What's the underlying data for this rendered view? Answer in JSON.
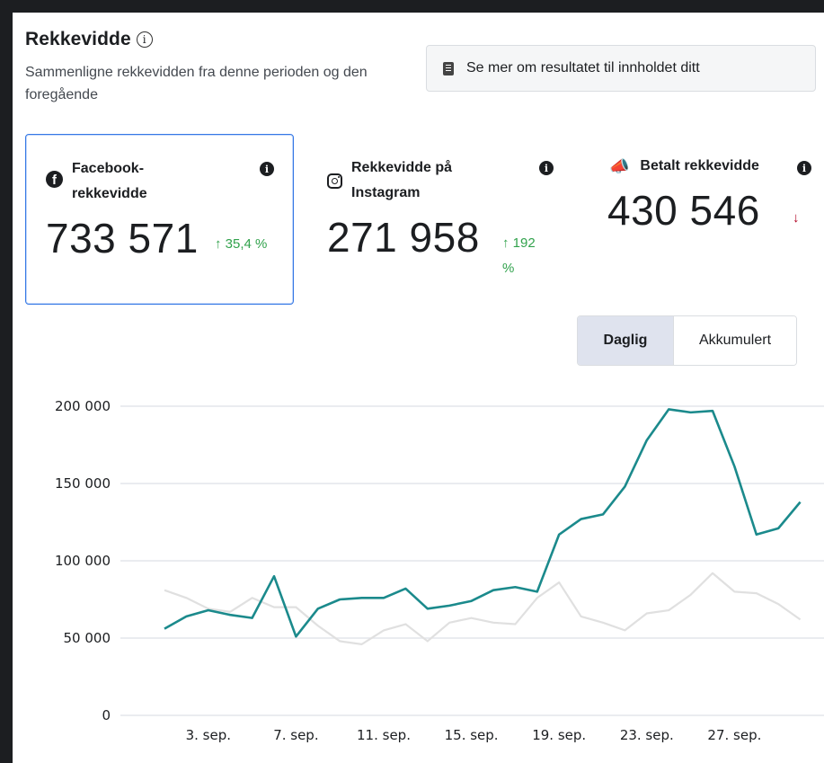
{
  "header": {
    "title": "Rekkevidde",
    "subtitle": "Sammenligne rekkevidden fra denne perioden og den foregående",
    "see_more_label": "Se mer om resultatet til innholdet ditt"
  },
  "metrics": {
    "facebook": {
      "label": "Facebook-rekkevidde",
      "value": "733 571",
      "change": "35,4 %",
      "direction": "up"
    },
    "instagram": {
      "label": "Rekkevidde på Instagram",
      "value": "271 958",
      "change": "192 %",
      "direction": "up"
    },
    "paid": {
      "label": "Betalt rekkevidde",
      "value": "430 546",
      "direction": "down"
    }
  },
  "toggle": {
    "daily_label": "Daglig",
    "cumulative_label": "Akkumulert",
    "selected": "Daglig"
  },
  "colors": {
    "current": "#1b8a8c",
    "previous": "#e0e0e0",
    "up": "#31a24c",
    "down": "#b00020",
    "selected_border": "#3578e5"
  },
  "chart_data": {
    "type": "line",
    "y_ticks": [
      "0",
      "50 000",
      "100 000",
      "150 000",
      "200 000"
    ],
    "ylim": [
      0,
      200000
    ],
    "x_tick_labels": [
      "3. sep.",
      "7. sep.",
      "11. sep.",
      "15. sep.",
      "19. sep.",
      "23. sep.",
      "27. sep."
    ],
    "x_tick_days": [
      3,
      7,
      11,
      15,
      19,
      23,
      27
    ],
    "x_days": [
      1,
      2,
      3,
      4,
      5,
      6,
      7,
      8,
      9,
      10,
      11,
      12,
      13,
      14,
      15,
      16,
      17,
      18,
      19,
      20,
      21,
      22,
      23,
      24,
      25,
      26,
      27,
      28,
      29,
      30
    ],
    "series": [
      {
        "key": "current",
        "values": [
          56000,
          64000,
          68000,
          65000,
          63000,
          90000,
          51000,
          69000,
          75000,
          76000,
          76000,
          82000,
          69000,
          71000,
          74000,
          81000,
          83000,
          80000,
          117000,
          127000,
          130000,
          148000,
          178000,
          198000,
          196000,
          197000,
          161000,
          117000,
          121000,
          138000
        ]
      },
      {
        "key": "previous",
        "values": [
          81000,
          76000,
          69000,
          67000,
          76000,
          70000,
          70000,
          58000,
          48000,
          46000,
          55000,
          59000,
          48000,
          60000,
          63000,
          60000,
          59000,
          76000,
          86000,
          64000,
          60000,
          55000,
          66000,
          68000,
          78000,
          92000,
          80000,
          79000,
          72000,
          62000
        ]
      }
    ]
  }
}
